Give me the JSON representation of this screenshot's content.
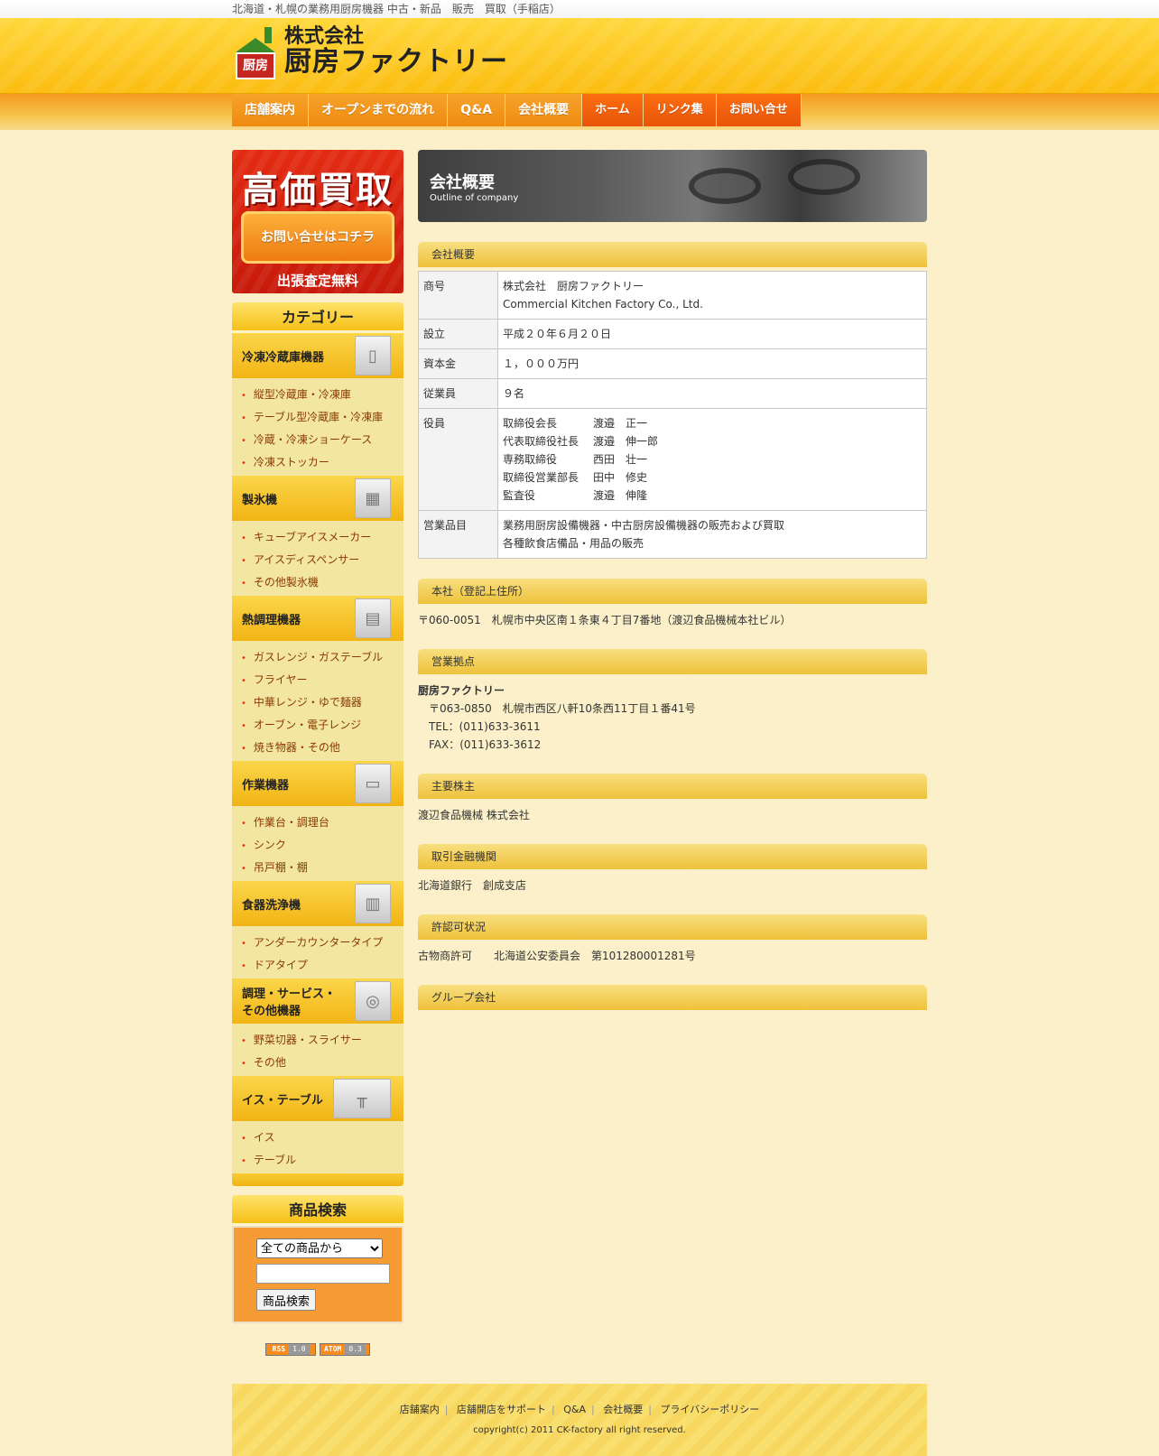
{
  "topbar": {
    "text": "北海道・札幌の業務用厨房機器 中古・新品　販売　買取（手稲店）"
  },
  "logo": {
    "mark": "厨房",
    "line1": "株式会社",
    "line2": "厨房ファクトリー"
  },
  "nav": {
    "items": [
      "店舗案内",
      "オープンまでの流れ",
      "Q&A",
      "会社概要"
    ],
    "right_items": [
      "ホーム",
      "リンク集",
      "お問い合せ"
    ]
  },
  "promo": {
    "title": "高価買取",
    "button": "お問い合せはコチラ",
    "note": "出張査定無料"
  },
  "categories": {
    "heading": "カテゴリー",
    "groups": [
      {
        "title": "冷凍冷蔵庫機器",
        "items": [
          "縦型冷蔵庫・冷凍庫",
          "テーブル型冷蔵庫・冷凍庫",
          "冷蔵・冷凍ショーケース",
          "冷凍ストッカー"
        ]
      },
      {
        "title": "製氷機",
        "items": [
          "キューブアイスメーカー",
          "アイスディスペンサー",
          "その他製氷機"
        ]
      },
      {
        "title": "熱調理機器",
        "items": [
          "ガスレンジ・ガステーブル",
          "フライヤー",
          "中華レンジ・ゆで麺器",
          "オーブン・電子レンジ",
          "焼き物器・その他"
        ]
      },
      {
        "title": "作業機器",
        "items": [
          "作業台・調理台",
          "シンク",
          "吊戸棚・棚"
        ]
      },
      {
        "title": "食器洗浄機",
        "items": [
          "アンダーカウンタータイプ",
          "ドアタイプ"
        ]
      },
      {
        "title": "調理・サービス・その他機器",
        "items": [
          "野菜切器・スライサー",
          "その他"
        ]
      },
      {
        "title": "イス・テーブル",
        "items": [
          "イス",
          "テーブル"
        ]
      }
    ]
  },
  "search": {
    "heading": "商品検索",
    "select_value": "全ての商品から",
    "button": "商品検索"
  },
  "feeds": {
    "rss": "RSS",
    "rss_ver": "1.0",
    "atom": "ATOM",
    "atom_ver": "0.3"
  },
  "hero": {
    "title": "会社概要",
    "subtitle": "Outline of company"
  },
  "outline": {
    "heading": "会社概要",
    "rows": {
      "name_k": "商号",
      "name_v1": "株式会社　厨房ファクトリー",
      "name_v2": "Commercial Kitchen Factory Co., Ltd.",
      "est_k": "設立",
      "est_v": "平成２０年６月２０日",
      "cap_k": "資本金",
      "cap_v": "１，０００万円",
      "emp_k": "従業員",
      "emp_v": "９名",
      "off_k": "役員",
      "roles": [
        [
          "取締役会長",
          "渡邉　正一"
        ],
        [
          "代表取締役社長",
          "渡邉　伸一郎"
        ],
        [
          "専務取締役",
          "西田　壮一"
        ],
        [
          "取締役営業部長",
          "田中　修史"
        ],
        [
          "監査役",
          "渡邉　伸隆"
        ]
      ],
      "biz_k": "営業品目",
      "biz_v1": "業務用厨房設備機器・中古厨房設備機器の販売および買取",
      "biz_v2": "各種飲食店備品・用品の販売"
    }
  },
  "hq": {
    "heading": "本社（登記上住所）",
    "address": "〒060-0051　札幌市中央区南１条東４丁目7番地（渡辺食品機械本社ビル）"
  },
  "branch": {
    "heading": "営業拠点",
    "name": "厨房ファクトリー",
    "address": "〒063-0850　札幌市西区八軒10条西11丁目１番41号",
    "tel": "TEL：(011)633-3611",
    "fax": "FAX：(011)633-3612"
  },
  "shareholder": {
    "heading": "主要株主",
    "text": "渡辺食品機械 株式会社"
  },
  "bank": {
    "heading": "取引金融機関",
    "text": "北海道銀行　創成支店"
  },
  "license": {
    "heading": "許認可状況",
    "text": "古物商許可　　北海道公安委員会　第101280001281号"
  },
  "group": {
    "heading": "グループ会社"
  },
  "footer": {
    "links": [
      "店舗案内",
      "店舗開店をサポート",
      "Q&A",
      "会社概要",
      "プライバシーポリシー"
    ],
    "copyright": "copyright(c) 2011 CK-factory all right reserved."
  }
}
